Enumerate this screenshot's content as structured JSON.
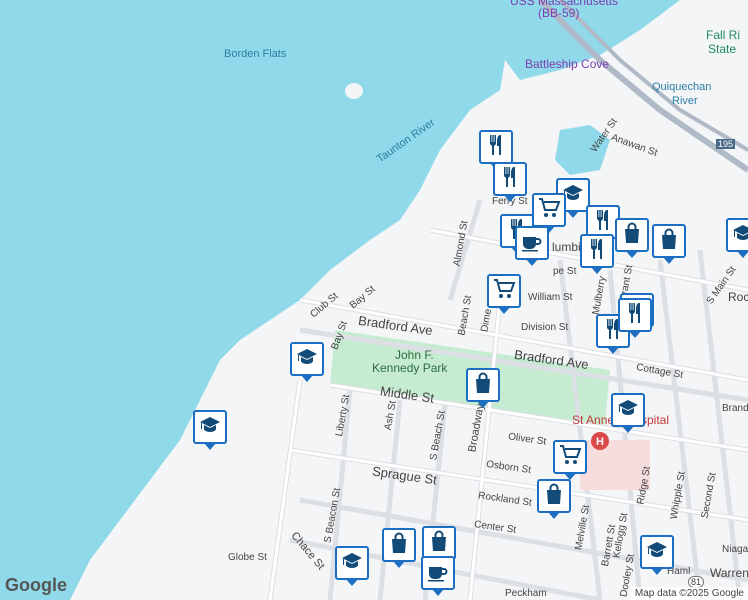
{
  "colors": {
    "water": "#8fd9ea",
    "land": "#f4f5f7",
    "road": "#ffffff",
    "road_line": "#d6d9de",
    "park": "#c5ecd0",
    "pin_border": "#1b6ec2",
    "pin_icon": "#124b78"
  },
  "labels": {
    "uss_mass": "USS Massachusetts",
    "bb59": "(BB-59)",
    "fall_river": "Fall Ri",
    "state": "State",
    "borden_flats": "Borden Flats",
    "battleship_cove": "Battleship Cove",
    "quequechan": "Quiquechan",
    "river": "River",
    "taunton": "Taunton River",
    "water_st": "Water St",
    "anawan_st": "Anawan St",
    "ferry_st": "Ferry St",
    "columbia": "lumbi",
    "almond_st": "Almond St",
    "pope_st": "pe St",
    "william_st": "William St",
    "mulberry": "Mulberry",
    "grant": "Grant St",
    "s_main": "S Main St",
    "rock": "Rock",
    "beach_st": "Beach St",
    "dimeo": "Dime",
    "division_st": "Division St",
    "club_st": "Club St",
    "bay_st": "Bay St",
    "bay_st2": "Bay St",
    "bradford": "Bradford Ave",
    "bradford2": "Bradford Ave",
    "cottage": "Cottage St",
    "jfk": "John F.",
    "jfk2": "Kennedy Park",
    "middle_st": "Middle St",
    "liberty": "Liberty St",
    "ash": "Ash St",
    "s_beach": "S Beach St",
    "broadway": "Broadway",
    "oliver": "Oliver St",
    "st_anne": "St Anne's Hospital",
    "brand": "Brand",
    "osborn": "Osborn St",
    "sprague": "Sprague St",
    "rockland": "Rockland St",
    "center": "Center St",
    "s_beacon": "S Beacon St",
    "chace": "Chace St",
    "globe": "Globe St",
    "melville": "Melville St",
    "barrett": "Barrett St",
    "kellogg": "Kellogg St",
    "dooley": "Dooley St",
    "ridge": "Ridge St",
    "whipple": "Whipple St",
    "second": "Second St",
    "niaga": "Niaga",
    "warren": "Warren",
    "peckham": "Peckham",
    "hamlet": "Haml",
    "route_195": "195",
    "route_81": "81",
    "hospital_h": "H"
  },
  "pins": [
    {
      "icon": "restaurant"
    },
    {
      "icon": "restaurant"
    },
    {
      "icon": "school"
    },
    {
      "icon": "grocery"
    },
    {
      "icon": "restaurant"
    },
    {
      "icon": "restaurant"
    },
    {
      "icon": "coffee"
    },
    {
      "icon": "restaurant"
    },
    {
      "icon": "shopping"
    },
    {
      "icon": "shopping"
    },
    {
      "icon": "school"
    },
    {
      "icon": "grocery"
    },
    {
      "icon": "restaurant"
    },
    {
      "icon": "restaurant"
    },
    {
      "icon": "school"
    },
    {
      "icon": "shopping"
    },
    {
      "icon": "school"
    },
    {
      "icon": "school"
    },
    {
      "icon": "grocery"
    },
    {
      "icon": "shopping"
    },
    {
      "icon": "shopping"
    },
    {
      "icon": "shopping"
    },
    {
      "icon": "restaurant"
    },
    {
      "icon": "school"
    },
    {
      "icon": "coffee"
    },
    {
      "icon": "school"
    }
  ],
  "google": "Google",
  "attribution": "Map data ©2025 Google"
}
